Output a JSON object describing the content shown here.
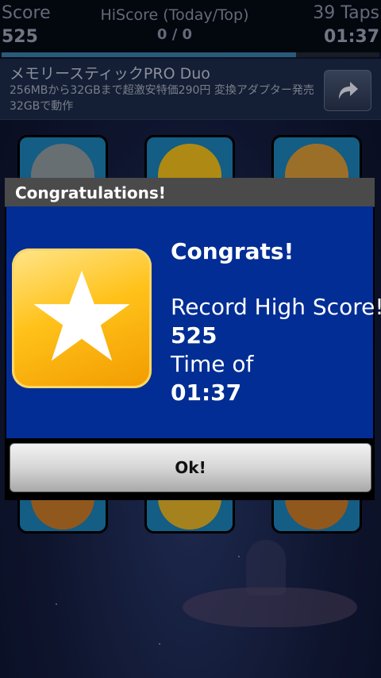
{
  "header": {
    "score_label": "Score",
    "score_value": "525",
    "hiscore_label": "HiScore (Today/Top)",
    "hiscore_value": "0 / 0",
    "taps_label": "39 Taps",
    "timer": "01:37",
    "progress_fraction": 0.78
  },
  "ad": {
    "title": "メモリースティックPRO Duo",
    "body": "256MBから32GBまで超激安特価290円 変換アダプター発売 32GBで動作",
    "arrow_icon": "share-arrow-icon"
  },
  "dialog": {
    "title": "Congratulations!",
    "icon": "star-icon",
    "line1": "Congrats!",
    "line2": "Record High Score!",
    "line3": "525",
    "line4": "Time of",
    "line5": "01:37",
    "ok_label": "Ok!"
  },
  "colors": {
    "dialog_body": "#022d94",
    "title_bar": "#4a4a4a",
    "progress": "#3a7fa8",
    "tile": "#1c82b8"
  }
}
